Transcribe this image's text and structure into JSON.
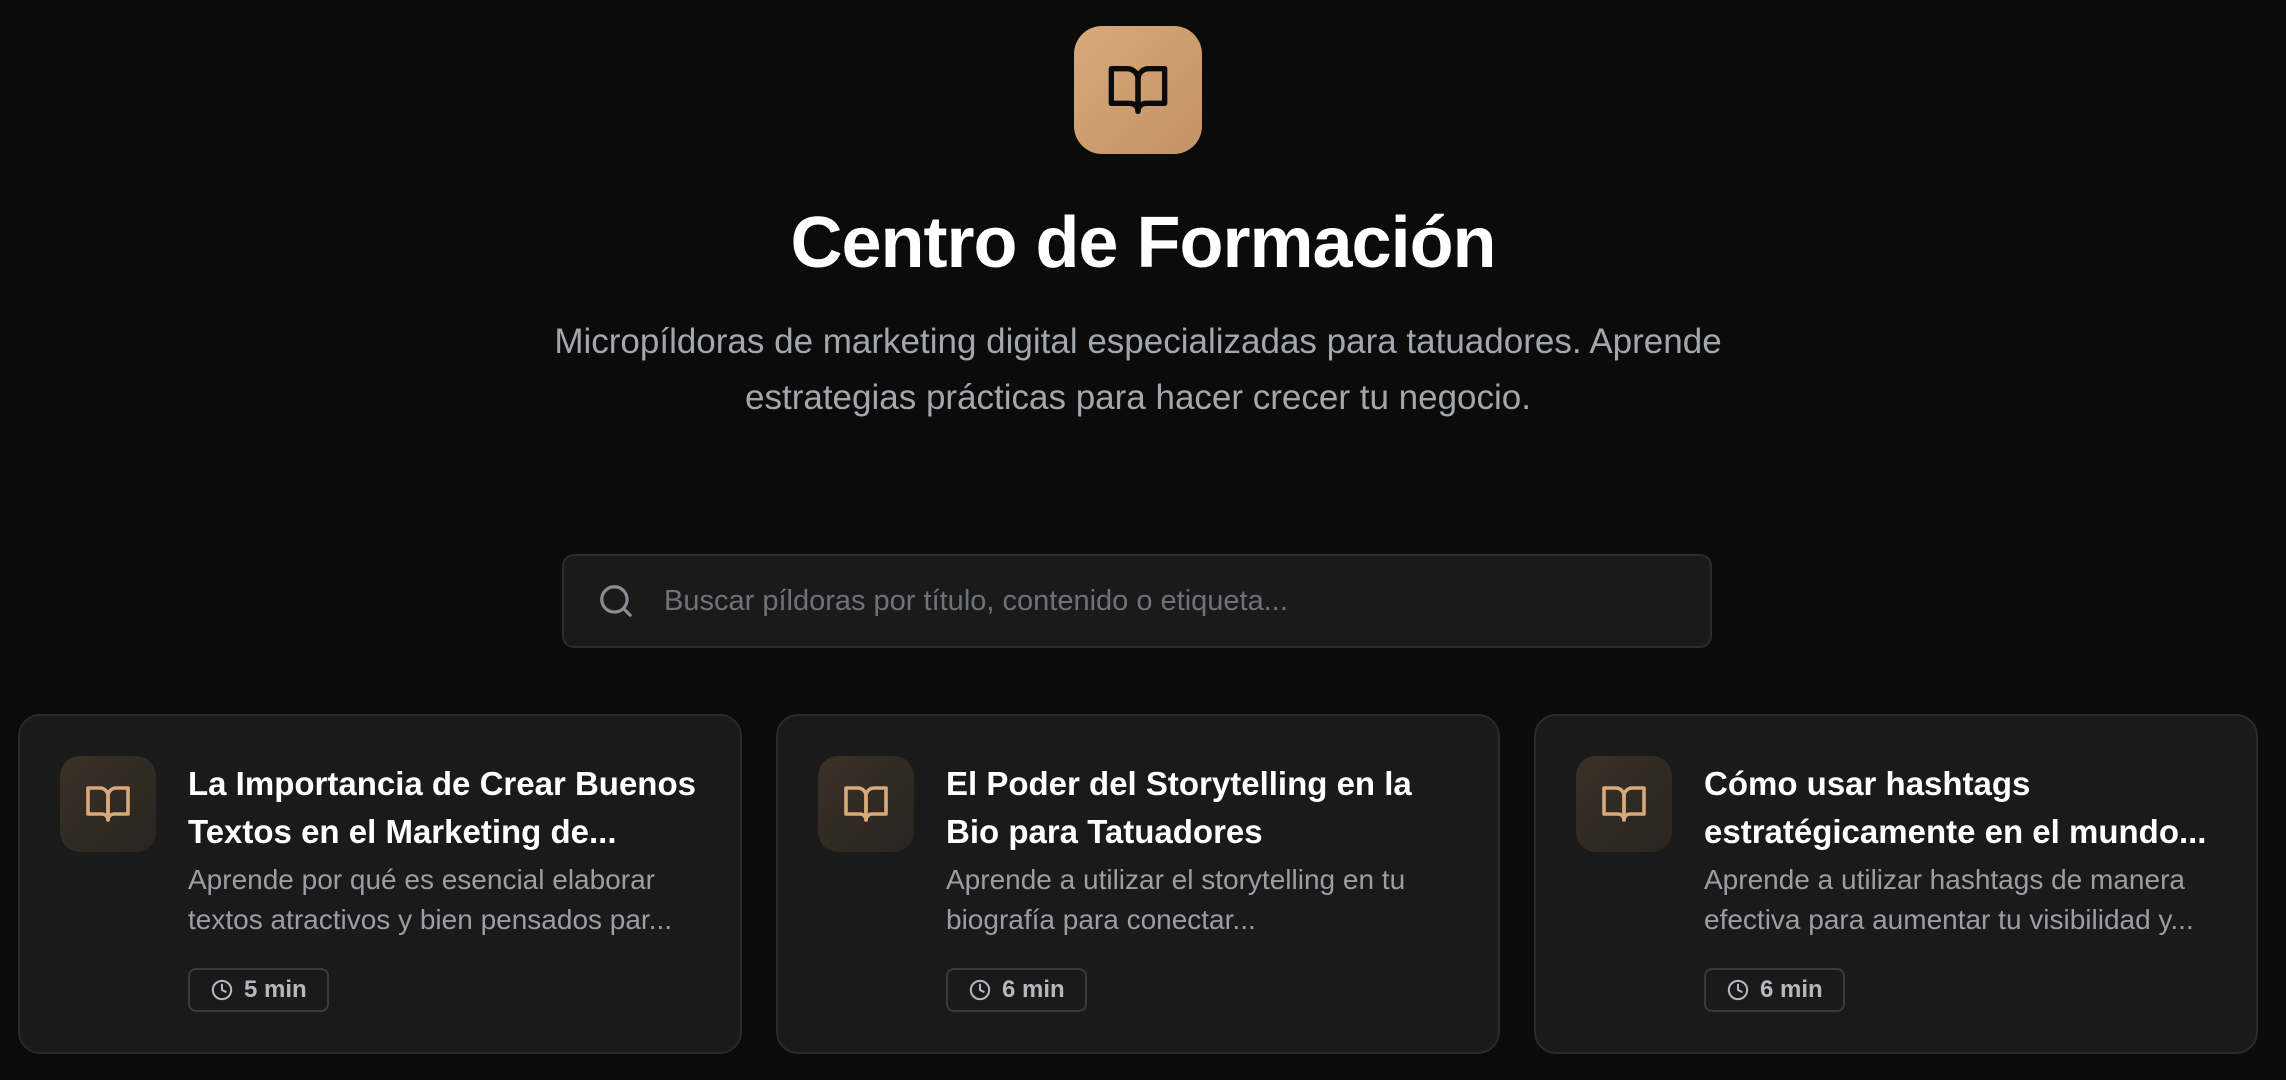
{
  "header": {
    "icon": "open-book-icon",
    "title": "Centro de Formación",
    "subtitle": "Micropíldoras de marketing digital especializadas para tatuadores. Aprende estrategias prácticas para hacer crecer tu negocio."
  },
  "search": {
    "icon": "search-icon",
    "value": "",
    "placeholder": "Buscar píldoras por título, contenido o etiqueta..."
  },
  "cards": [
    {
      "icon": "open-book-icon",
      "title": "La Importancia de Crear Buenos Textos en el Marketing de...",
      "description": "Aprende por qué es esencial elaborar textos atractivos y bien pensados par...",
      "duration_icon": "clock-icon",
      "duration": "5 min"
    },
    {
      "icon": "open-book-icon",
      "title": "El Poder del Storytelling en la Bio para Tatuadores",
      "description": "Aprende a utilizar el storytelling en tu biografía para conectar...",
      "duration_icon": "clock-icon",
      "duration": "6 min"
    },
    {
      "icon": "open-book-icon",
      "title": "Cómo usar hashtags estratégicamente en el mundo...",
      "description": "Aprende a utilizar hashtags de manera efectiva para aumentar tu visibilidad y...",
      "duration_icon": "clock-icon",
      "duration": "6 min"
    }
  ],
  "colors": {
    "background": "#0b0b0b",
    "accent": "#d8a97a",
    "card_background": "#1a1a1a",
    "muted_text": "#a3a6ad"
  }
}
